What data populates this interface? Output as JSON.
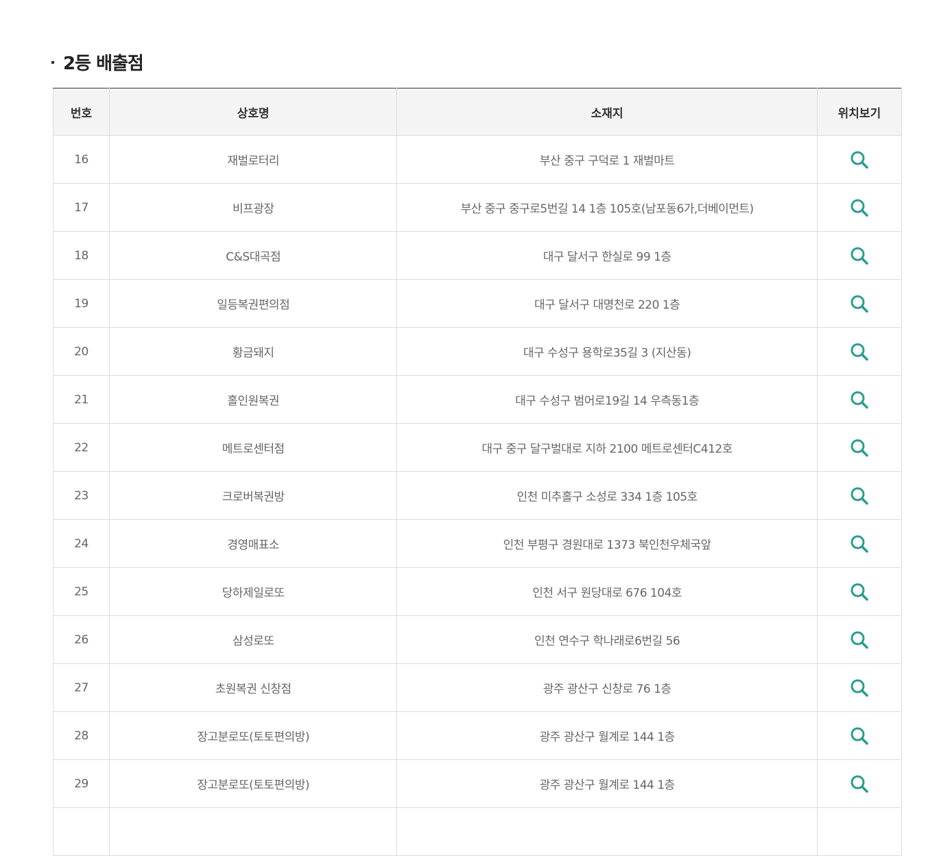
{
  "section": {
    "title": "2등 배출점"
  },
  "table": {
    "headers": [
      "번호",
      "상호명",
      "소재지",
      "위치보기"
    ],
    "rows": [
      {
        "no": "16",
        "name": "재벌로터리",
        "address": "부산 중구 구덕로 1 재벌마트"
      },
      {
        "no": "17",
        "name": "비프광장",
        "address": "부산 중구 중구로5번길 14 1층 105호(남포동6가,더베이먼트)"
      },
      {
        "no": "18",
        "name": "C&S대곡점",
        "address": "대구 달서구 한실로 99 1층"
      },
      {
        "no": "19",
        "name": "일등복권편의점",
        "address": "대구 달서구 대명천로 220 1층"
      },
      {
        "no": "20",
        "name": "황금돼지",
        "address": "대구 수성구 용학로35길 3 (지산동)"
      },
      {
        "no": "21",
        "name": "홀인원복권",
        "address": "대구 수성구 범어로19길 14 우측동1층"
      },
      {
        "no": "22",
        "name": "메트로센터점",
        "address": "대구 중구 달구벌대로 지하 2100 메트로센터C412호"
      },
      {
        "no": "23",
        "name": "크로버복권방",
        "address": "인천 미추홀구 소성로 334 1층 105호"
      },
      {
        "no": "24",
        "name": "경영매표소",
        "address": "인천 부평구 경원대로 1373 북인천우체국앞"
      },
      {
        "no": "25",
        "name": "당하제일로또",
        "address": "인천 서구 원당대로 676 104호"
      },
      {
        "no": "26",
        "name": "삼성로또",
        "address": "인천 연수구 학나래로6번길 56"
      },
      {
        "no": "27",
        "name": "초원복권 신창점",
        "address": "광주 광산구 신창로 76 1층"
      },
      {
        "no": "28",
        "name": "장고분로또(토토편의방)",
        "address": "광주 광산구 월계로 144 1층"
      },
      {
        "no": "29",
        "name": "장고분로또(토토편의방)",
        "address": "광주 광산구 월계로 144 1층"
      },
      {
        "no": "",
        "name": "",
        "address": ""
      }
    ]
  },
  "icons": {
    "map_button": "search-icon"
  },
  "colors": {
    "icon": "#2a9d8f",
    "header_bg": "#f4f4f4",
    "border": "#dcdcdc",
    "top_border": "#333333"
  }
}
